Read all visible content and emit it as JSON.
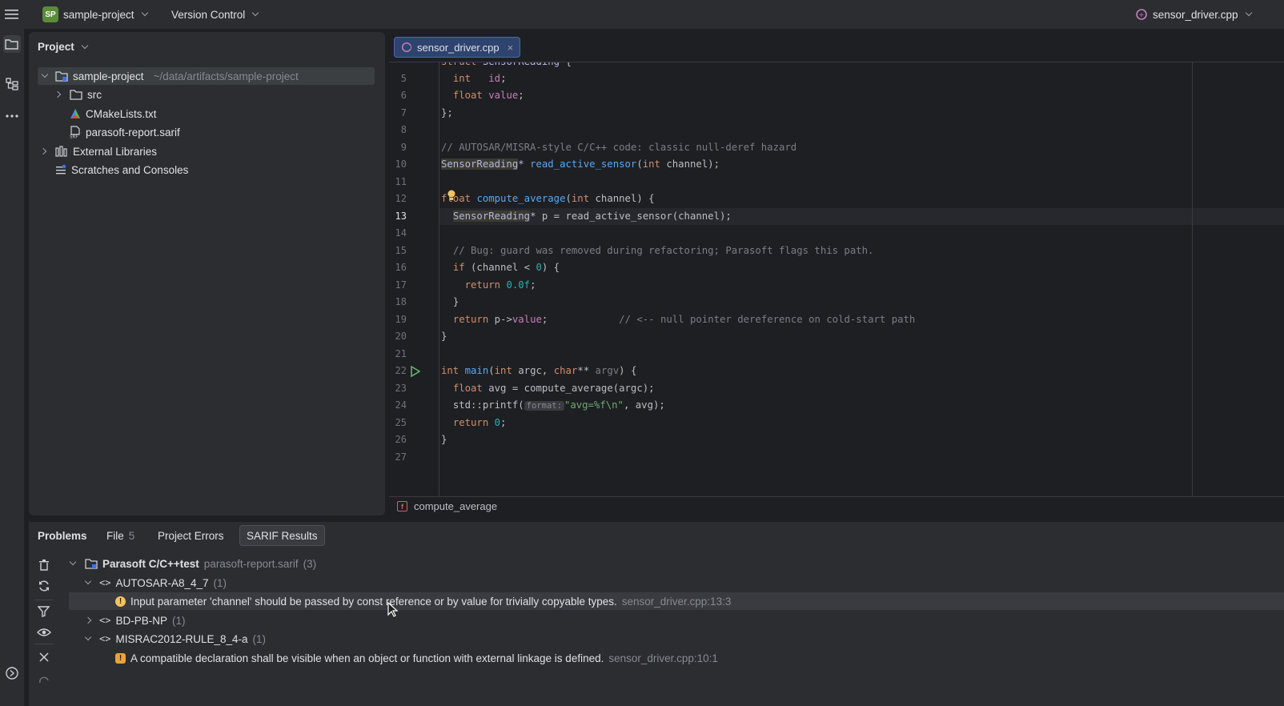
{
  "topbar": {
    "project_initials": "SP",
    "project_name": "sample-project",
    "vcs_label": "Version Control",
    "current_file": "sensor_driver.cpp"
  },
  "project_panel": {
    "title": "Project",
    "items": [
      {
        "label": "sample-project",
        "path": "~/data/artifacts/sample-project"
      },
      {
        "label": "src"
      },
      {
        "label": "CMakeLists.txt"
      },
      {
        "label": "parasoft-report.sarif"
      },
      {
        "label": "External Libraries"
      },
      {
        "label": "Scratches and Consoles"
      }
    ]
  },
  "editor": {
    "tab_label": "sensor_driver.cpp",
    "line_numbers": [
      "5",
      "6",
      "7",
      "8",
      "9",
      "10",
      "11",
      "12",
      "13",
      "14",
      "15",
      "16",
      "17",
      "18",
      "19",
      "20",
      "21",
      "22",
      "23",
      "24",
      "25",
      "26",
      "27"
    ],
    "format_hint": "format:",
    "lines": {
      "l5": "int   id;",
      "l6a": "float",
      "l6b": "value",
      "l9": "// AUTOSAR/MISRA-style C/C++ code: classic null-deref hazard",
      "l15": "// Bug: guard was removed during refactoring; Parasoft flags this path.",
      "l19c": "// <-- null pointer dereference on cold-start path"
    },
    "breadcrumb": "compute_average"
  },
  "problems": {
    "tabs": [
      {
        "label": "Problems"
      },
      {
        "label": "File",
        "count": "5"
      },
      {
        "label": "Project Errors"
      },
      {
        "label": "SARIF Results"
      }
    ],
    "tool_root": {
      "label": "Parasoft C/C++test",
      "file": "parasoft-report.sarif",
      "count": "(3)"
    },
    "rules": [
      {
        "label": "AUTOSAR-A8_4_7",
        "count": "(1)"
      },
      {
        "label": "BD-PB-NP",
        "count": "(1)"
      },
      {
        "label": "MISRAC2012-RULE_8_4-a",
        "count": "(1)"
      }
    ],
    "issues": [
      {
        "message": "Input parameter 'channel' should be passed by const reference or by value for trivially copyable types.",
        "location": "sensor_driver.cpp:13:3"
      },
      {
        "message": "A compatible declaration shall be visible when an object or function with external linkage is defined.",
        "location": "sensor_driver.cpp:10:1"
      }
    ]
  }
}
